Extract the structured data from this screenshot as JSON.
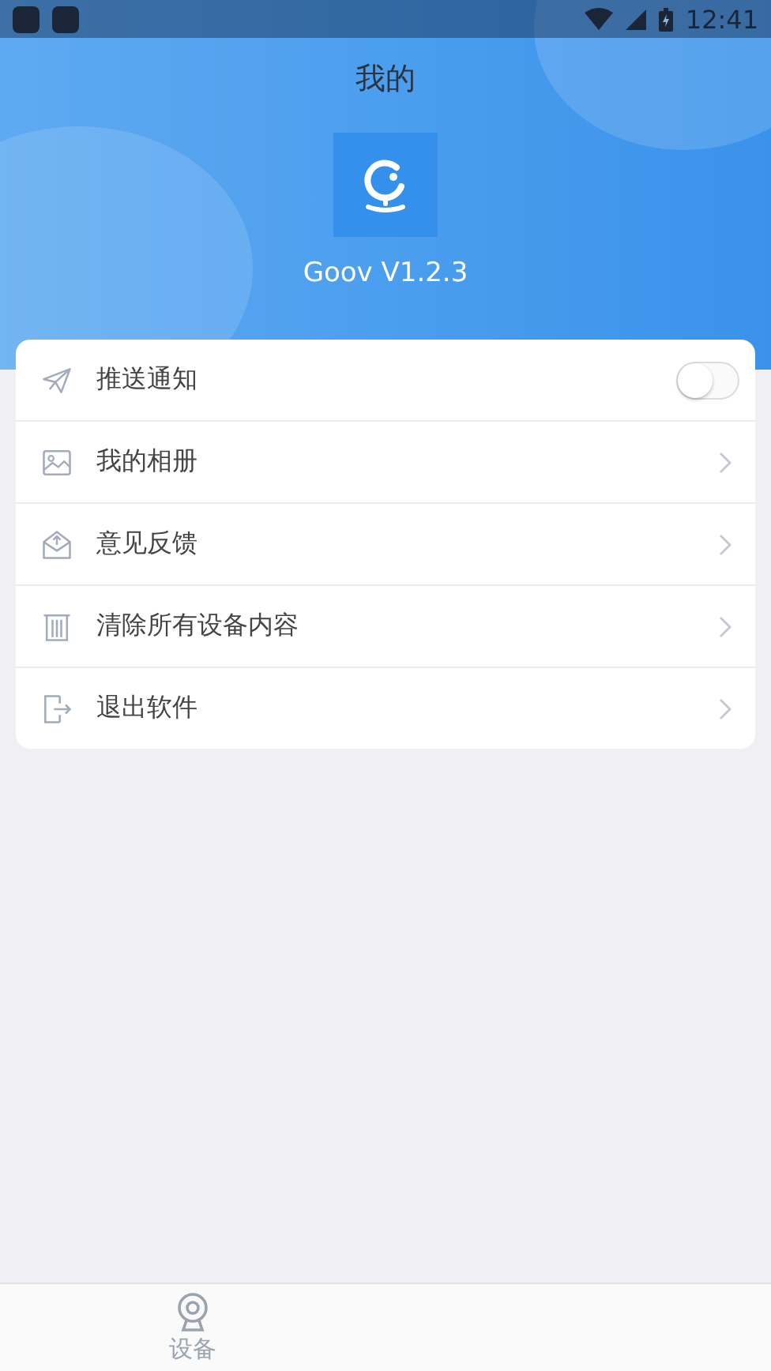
{
  "status_bar": {
    "time": "12:41"
  },
  "header": {
    "title": "我的",
    "app_name": "Goov V1.2.3"
  },
  "menu": [
    {
      "kind": "toggle",
      "label": "推送通知",
      "on": false
    },
    {
      "kind": "link",
      "label": "我的相册"
    },
    {
      "kind": "link",
      "label": "意见反馈"
    },
    {
      "kind": "link",
      "label": "清除所有设备内容"
    },
    {
      "kind": "link",
      "label": "退出软件"
    }
  ],
  "tabs": [
    {
      "label": "设备",
      "selected": false
    }
  ]
}
